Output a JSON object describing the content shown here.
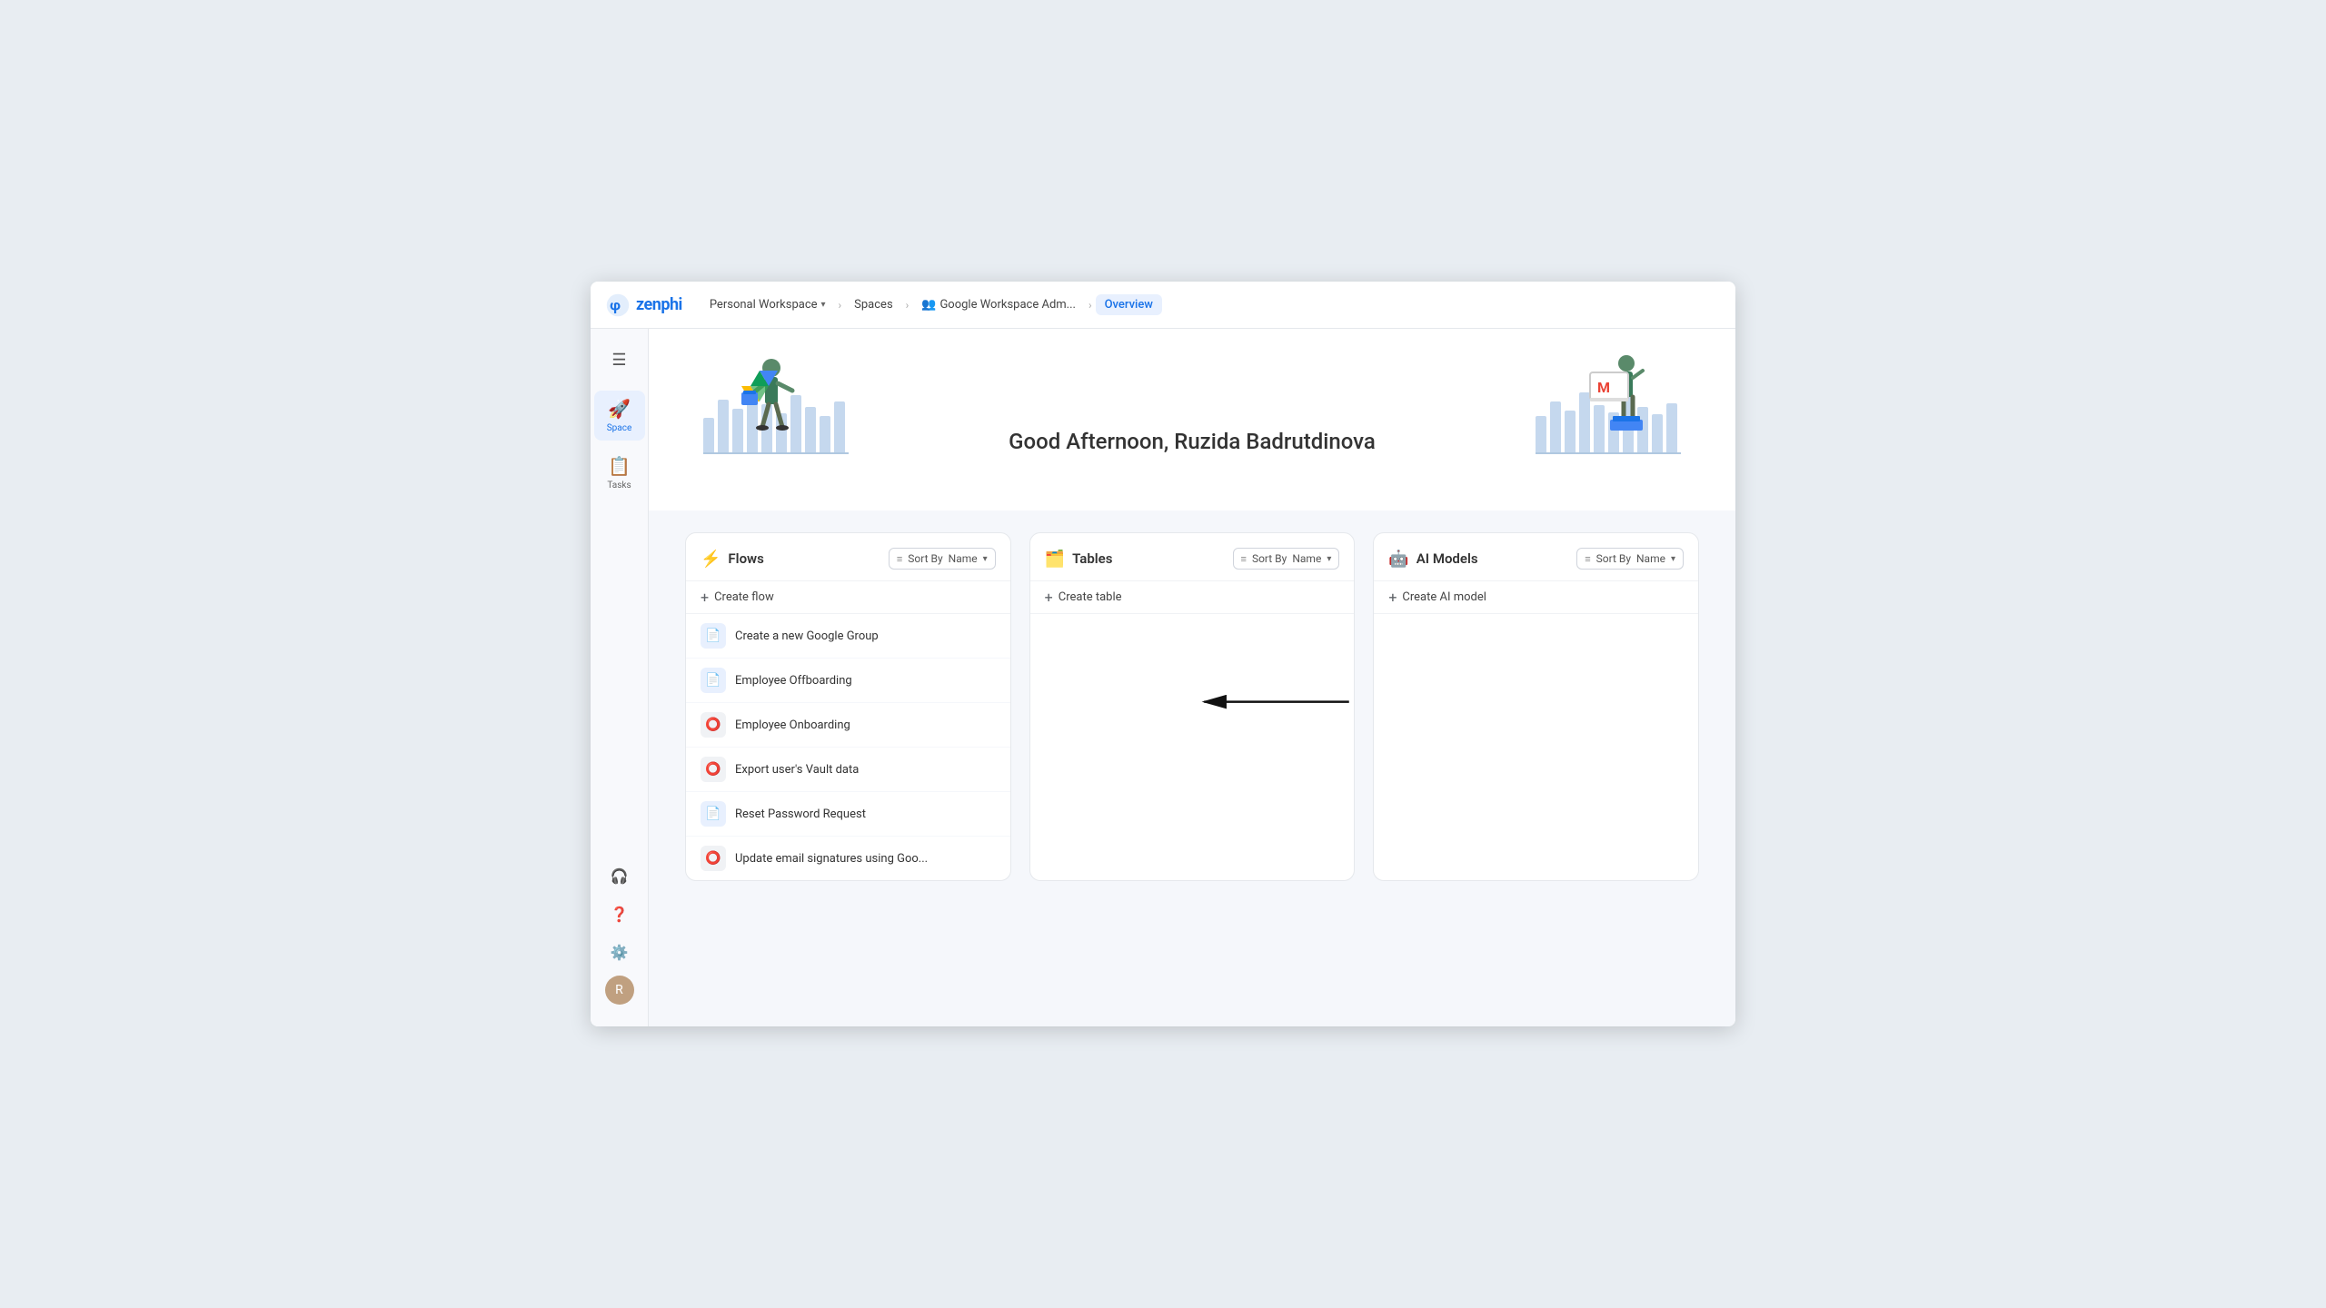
{
  "app": {
    "logo_text": "zenphi"
  },
  "topnav": {
    "menu_label": "≡",
    "workspace_label": "Personal Workspace",
    "spaces_label": "Spaces",
    "google_admin_label": "Google Workspace Adm...",
    "overview_label": "Overview"
  },
  "sidebar": {
    "items": [
      {
        "id": "space",
        "label": "Space",
        "icon": "🚀",
        "active": true
      },
      {
        "id": "tasks",
        "label": "Tasks",
        "icon": "📋",
        "active": false
      }
    ],
    "bottom_icons": [
      {
        "id": "headset",
        "icon": "🎧"
      },
      {
        "id": "help",
        "icon": "❓"
      },
      {
        "id": "settings",
        "icon": "⚙️"
      }
    ],
    "avatar_initial": "R"
  },
  "hero": {
    "greeting": "Good Afternoon, Ruzida Badrutdinova"
  },
  "cards": {
    "flows": {
      "title": "Flows",
      "sort_label": "Name",
      "sort_by_label": "Sort By",
      "create_btn": "Create flow",
      "items": [
        {
          "id": 1,
          "name": "Create a new Google Group",
          "icon_type": "blue"
        },
        {
          "id": 2,
          "name": "Employee Offboarding",
          "icon_type": "blue"
        },
        {
          "id": 3,
          "name": "Employee Onboarding",
          "icon_type": "gray"
        },
        {
          "id": 4,
          "name": "Export user's Vault data",
          "icon_type": "gray"
        },
        {
          "id": 5,
          "name": "Reset Password Request",
          "icon_type": "blue"
        },
        {
          "id": 6,
          "name": "Update email signatures using Goo...",
          "icon_type": "gray"
        }
      ]
    },
    "tables": {
      "title": "Tables",
      "sort_label": "Name",
      "sort_by_label": "Sort By",
      "create_btn": "Create table",
      "items": []
    },
    "ai_models": {
      "title": "AI Models",
      "sort_label": "Name",
      "sort_by_label": "Sort By",
      "create_btn": "Create AI model",
      "items": []
    }
  },
  "annotation_arrow": {
    "visible": true,
    "target": "Employee Offboarding"
  }
}
